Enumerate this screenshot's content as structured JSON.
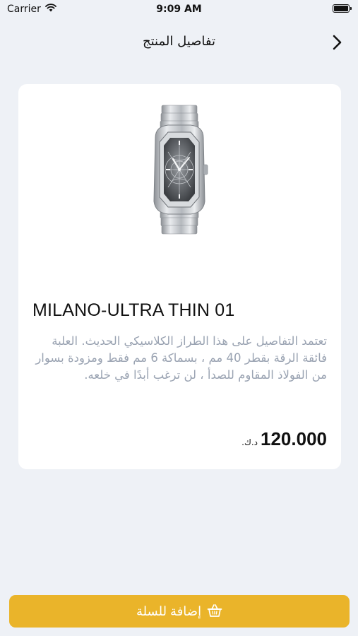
{
  "status_bar": {
    "carrier": "Carrier",
    "time": "9:09 AM"
  },
  "nav": {
    "title": "تفاصيل المنتج"
  },
  "product": {
    "name": "MILANO-ULTRA THIN 01",
    "description": "تعتمد التفاصيل على هذا الطراز الكلاسيكي الحديث. العلبة فائقة الرقة بقطر 40 مم ، بسماكة 6 مم فقط ومزودة بسوار من الفولاذ المقاوم للصدأ ، لن ترغب أبدًا في خلعه.",
    "price": "120.000",
    "currency": "د.ك."
  },
  "cart_button": {
    "label": "إضافة للسلة"
  },
  "colors": {
    "accent": "#eab42a",
    "background": "#eef1f6",
    "description_text": "#9aa3b2"
  }
}
